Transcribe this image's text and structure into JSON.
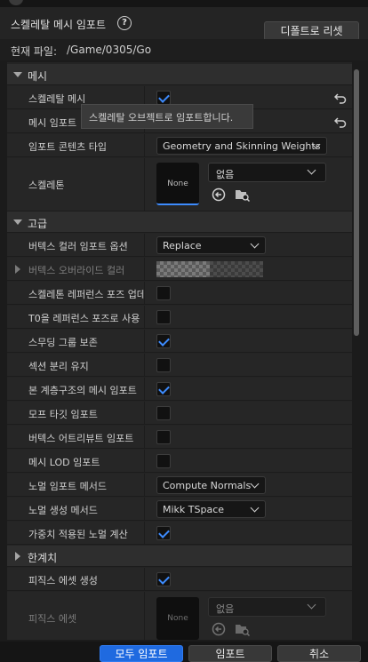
{
  "dialog": {
    "title": "스켈레탈 메시 임포트",
    "reset_label": "디폴트로 리셋"
  },
  "file": {
    "label": "현재 파일:",
    "path": "/Game/0305/Go"
  },
  "tooltip": "스켈레탈 오브젝트로 임포트합니다.",
  "mesh_section": {
    "label": "메시",
    "skeletal_mesh_label": "스켈레탈 메시",
    "skeletal_mesh_checked": true,
    "import_mesh_label": "메시 임포트",
    "import_mesh_checked": true,
    "content_type_label": "임포트 콘텐츠 타입",
    "content_type_value": "Geometry and Skinning Weights",
    "skeleton_label": "스켈레톤",
    "skeleton_thumb": "None",
    "skeleton_value": "없음"
  },
  "advanced_section": {
    "label": "고급",
    "vertex_color_label": "버텍스 컬러 임포트 옵션",
    "vertex_color_value": "Replace",
    "vertex_override_label": "버텍스 오버라이드 컬러",
    "rows": [
      {
        "label": "스켈레톤 레퍼런스 포즈 업데이트",
        "checked": false
      },
      {
        "label": "T0을 레퍼런스 포즈로 사용",
        "checked": false
      },
      {
        "label": "스무딩 그룹 보존",
        "checked": true
      },
      {
        "label": "섹션 분리 유지",
        "checked": false
      },
      {
        "label": "본 계층구조의 메시 임포트",
        "checked": true
      },
      {
        "label": "모프 타깃 임포트",
        "checked": false
      },
      {
        "label": "버텍스 어트리뷰트 임포트",
        "checked": false
      },
      {
        "label": "메시 LOD 임포트",
        "checked": false
      }
    ],
    "normal_import_label": "노멀 임포트 메서드",
    "normal_import_value": "Compute Normals",
    "normal_gen_label": "노멀 생성 메서드",
    "normal_gen_value": "Mikk TSpace",
    "weighted_normals_label": "가중치 적용된 노멀 계산",
    "weighted_normals_checked": true
  },
  "threshold_section": {
    "label": "한계치"
  },
  "physics": {
    "create_label": "피직스 에셋 생성",
    "create_checked": true,
    "asset_label": "피직스 에셋",
    "asset_thumb": "None",
    "asset_value": "없음"
  },
  "footer": {
    "import_all": "모두 임포트",
    "import": "임포트",
    "cancel": "취소"
  }
}
